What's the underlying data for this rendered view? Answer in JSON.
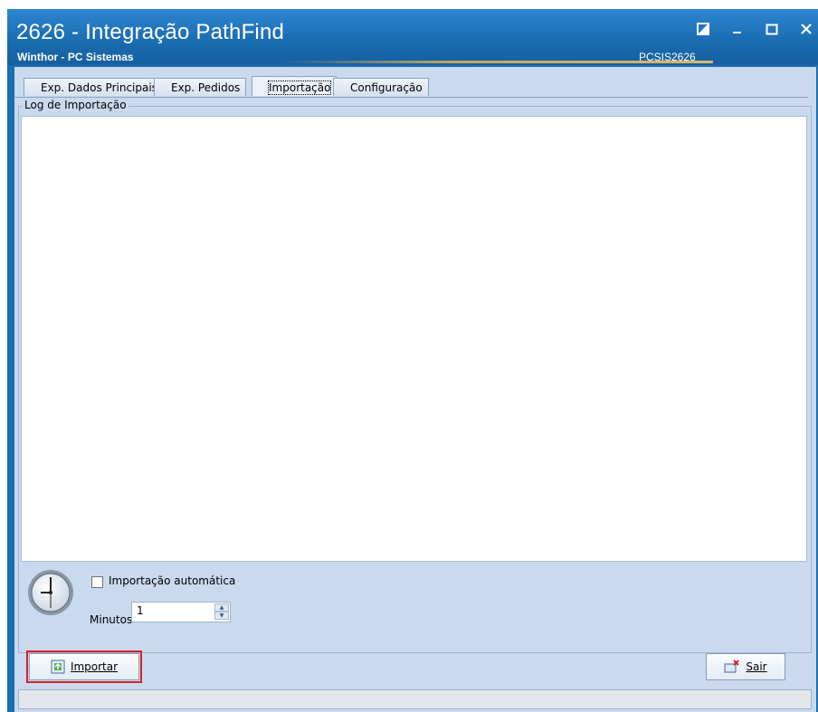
{
  "window": {
    "title": "2626 - Integração PathFind",
    "subtitle": "Winthor - PC Sistemas",
    "code": "PCSIS2626"
  },
  "tabs": [
    {
      "label": "Exp. Dados Principais",
      "active": false
    },
    {
      "label": "Exp. Pedidos",
      "active": false
    },
    {
      "label": "Importação",
      "active": true
    },
    {
      "label": "Configuração",
      "active": false
    }
  ],
  "log_group": {
    "label": "Log de Importação"
  },
  "auto_import": {
    "checkbox_label": "Importação automática",
    "checked": false,
    "minutes_label": "Minutos",
    "minutes_value": "1"
  },
  "buttons": {
    "import_label": "Importar",
    "exit_label": "Sair"
  },
  "icons": {
    "window": [
      "restore-icon",
      "minimize-icon",
      "maximize-icon",
      "close-icon"
    ],
    "clock": "clock-icon",
    "import": "import-icon",
    "exit": "exit-icon"
  },
  "colors": {
    "titlebar": "#1a6bb0",
    "client_bg": "#c9daee",
    "highlight_border": "#d62027"
  }
}
